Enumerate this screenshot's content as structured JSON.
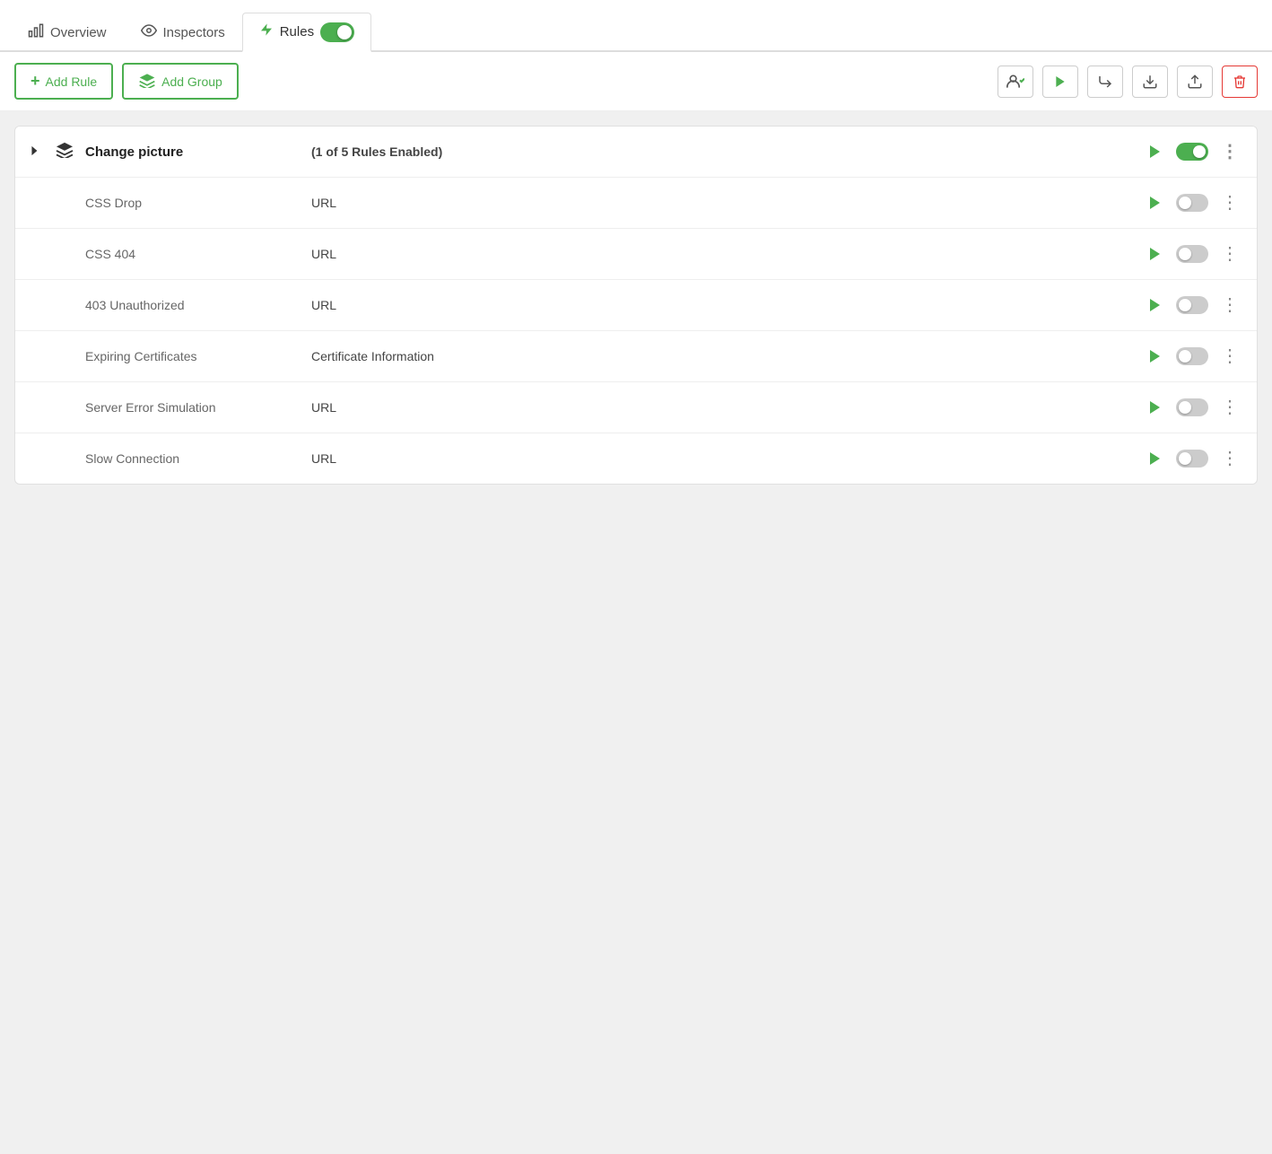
{
  "tabs": [
    {
      "id": "overview",
      "label": "Overview",
      "icon": "bar-chart",
      "active": false
    },
    {
      "id": "inspectors",
      "label": "Inspectors",
      "icon": "eye",
      "active": false
    },
    {
      "id": "rules",
      "label": "Rules",
      "icon": "lightning",
      "active": true,
      "toggle": true,
      "toggleOn": true
    }
  ],
  "toolbar": {
    "add_rule_label": "Add Rule",
    "add_group_label": "Add Group"
  },
  "rules": [
    {
      "id": "change-picture",
      "name": "Change picture",
      "type": "(1 of 5 Rules Enabled)",
      "isGroup": true,
      "enabled": true,
      "expanded": false
    },
    {
      "id": "css-drop",
      "name": "CSS Drop",
      "type": "URL",
      "isGroup": false,
      "enabled": false
    },
    {
      "id": "css-404",
      "name": "CSS 404",
      "type": "URL",
      "isGroup": false,
      "enabled": false
    },
    {
      "id": "403-unauthorized",
      "name": "403 Unauthorized",
      "type": "URL",
      "isGroup": false,
      "enabled": false
    },
    {
      "id": "expiring-certificates",
      "name": "Expiring Certificates",
      "type": "Certificate Information",
      "isGroup": false,
      "enabled": false
    },
    {
      "id": "server-error-simulation",
      "name": "Server Error Simulation",
      "type": "URL",
      "isGroup": false,
      "enabled": false
    },
    {
      "id": "slow-connection",
      "name": "Slow Connection",
      "type": "URL",
      "isGroup": false,
      "enabled": false
    }
  ],
  "icons": {
    "bar_chart": "📊",
    "eye": "👁",
    "lightning": "⚡",
    "layers": "≡",
    "play": "▶",
    "add_users": "👥",
    "export": "⬇",
    "import": "⬆",
    "forward": "↪",
    "trash": "🗑",
    "more": "⋮",
    "chevron_right": "▶"
  },
  "colors": {
    "green": "#4caf50",
    "red": "#e53935",
    "gray": "#ccc"
  }
}
